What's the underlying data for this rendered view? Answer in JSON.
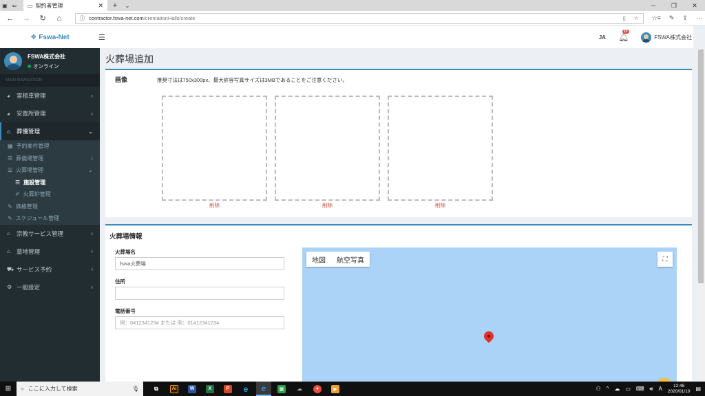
{
  "browser": {
    "tab_title": "契約者管理",
    "url_domain": "contractor.fswa-net.com",
    "url_path": "/cremationHalls/create"
  },
  "header": {
    "brand": "Fswa-Net",
    "lang": "JA",
    "notif_count": "23",
    "user_name": "FSWA株式会社"
  },
  "sidebar": {
    "company": "FSWA株式会社",
    "status": "オンライン",
    "section_label": "MAIN NAVIGATION",
    "items": [
      {
        "label": "霊柩車管理"
      },
      {
        "label": "安置所管理"
      },
      {
        "label": "葬儀管理"
      },
      {
        "label": "宗教サービス管理"
      },
      {
        "label": "墓地管理"
      },
      {
        "label": "サービス予約"
      },
      {
        "label": "一般設定"
      }
    ],
    "sub": [
      {
        "label": "予約案件管理"
      },
      {
        "label": "葬儀場管理"
      },
      {
        "label": "火葬場管理"
      },
      {
        "label": "施設管理"
      },
      {
        "label": "火葬炉管理"
      },
      {
        "label": "価格管理"
      },
      {
        "label": "スケジュール管理"
      }
    ]
  },
  "page": {
    "title": "火葬場追加",
    "image_section": {
      "label": "画像",
      "note": "推奨寸法は750x300px、最大許容写真サイズは3MBであることをご注意ください。",
      "delete_label": "削除"
    },
    "info_section": {
      "title": "火葬場情報",
      "name_label": "火葬場名",
      "name_value": "fswa火葬場",
      "address_label": "住所",
      "address_value": "",
      "phone_label": "電話番号",
      "phone_placeholder": "例：0412341234 または 例：01412341234"
    },
    "map": {
      "map_type_map": "地図",
      "map_type_satellite": "航空写真"
    }
  },
  "taskbar": {
    "search_placeholder": "ここに入力して検索",
    "time": "12:48",
    "date": "2020/01/10"
  }
}
